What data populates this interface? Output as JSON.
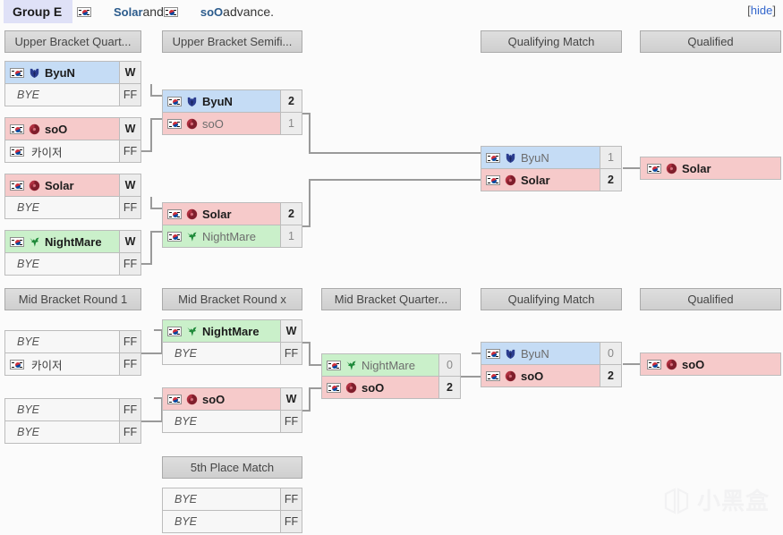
{
  "header": {
    "group_label": "Group E",
    "advance_prefix": "",
    "advance_p1": "Solar",
    "advance_join": " and ",
    "advance_p2": "soO",
    "advance_suffix": " advance.",
    "hide_open": "[",
    "hide_label": "hide",
    "hide_close": "]"
  },
  "colors": {
    "terran": "#c5dcf5",
    "zerg": "#f6caca",
    "protoss": "#caf0ca",
    "header_bg": "#dedede",
    "group_tag_bg": "#dfe1f7",
    "link": "#36c",
    "connector": "#9a9a9a"
  },
  "rounds": {
    "ub_quarter": "Upper Bracket Quart...",
    "ub_semi": "Upper Bracket Semifi...",
    "qualifying_top": "Qualifying Match",
    "qualified_top": "Qualified",
    "mid_round1": "Mid Bracket Round 1",
    "mid_roundx": "Mid Bracket Round x",
    "mid_quarter": "Mid Bracket Quarter...",
    "qualifying_bottom": "Qualifying Match",
    "qualified_bottom": "Qualified",
    "fifth_place": "5th Place Match"
  },
  "ub_quarterfinals": [
    {
      "rows": [
        {
          "name": "ByuN",
          "race": "terran",
          "flag": "kr",
          "score": "W",
          "state": "win"
        },
        {
          "name": "BYE",
          "race": "bye",
          "flag": "none",
          "score": "FF",
          "state": "bye"
        }
      ]
    },
    {
      "rows": [
        {
          "name": "soO",
          "race": "zerg",
          "flag": "kr",
          "score": "W",
          "state": "win"
        },
        {
          "name": "카이저",
          "race": "bye",
          "flag": "kr",
          "score": "FF",
          "state": "bye-named"
        }
      ]
    },
    {
      "rows": [
        {
          "name": "Solar",
          "race": "zerg",
          "flag": "kr",
          "score": "W",
          "state": "win"
        },
        {
          "name": "BYE",
          "race": "bye",
          "flag": "none",
          "score": "FF",
          "state": "bye"
        }
      ]
    },
    {
      "rows": [
        {
          "name": "NightMare",
          "race": "protoss",
          "flag": "kr",
          "score": "W",
          "state": "win"
        },
        {
          "name": "BYE",
          "race": "bye",
          "flag": "none",
          "score": "FF",
          "state": "bye"
        }
      ]
    }
  ],
  "ub_semifinals": [
    {
      "rows": [
        {
          "name": "ByuN",
          "race": "terran",
          "flag": "kr",
          "score": "2",
          "state": "win"
        },
        {
          "name": "soO",
          "race": "zerg",
          "flag": "kr",
          "score": "1",
          "state": "lose"
        }
      ]
    },
    {
      "rows": [
        {
          "name": "Solar",
          "race": "zerg",
          "flag": "kr",
          "score": "2",
          "state": "win"
        },
        {
          "name": "NightMare",
          "race": "protoss",
          "flag": "kr",
          "score": "1",
          "state": "lose"
        }
      ]
    }
  ],
  "qualifying_match_top": {
    "rows": [
      {
        "name": "ByuN",
        "race": "terran",
        "flag": "kr",
        "score": "1",
        "state": "lose"
      },
      {
        "name": "Solar",
        "race": "zerg",
        "flag": "kr",
        "score": "2",
        "state": "win"
      }
    ]
  },
  "qualified_top": {
    "rows": [
      {
        "name": "Solar",
        "race": "zerg",
        "flag": "kr",
        "score": "",
        "state": "win"
      }
    ]
  },
  "mid_round1": [
    {
      "rows": [
        {
          "name": "BYE",
          "race": "bye",
          "flag": "none",
          "score": "FF",
          "state": "bye"
        },
        {
          "name": "카이저",
          "race": "bye",
          "flag": "kr",
          "score": "FF",
          "state": "bye-named"
        }
      ]
    },
    {
      "rows": [
        {
          "name": "BYE",
          "race": "bye",
          "flag": "none",
          "score": "FF",
          "state": "bye"
        },
        {
          "name": "BYE",
          "race": "bye",
          "flag": "none",
          "score": "FF",
          "state": "bye"
        }
      ]
    }
  ],
  "mid_roundx": [
    {
      "rows": [
        {
          "name": "NightMare",
          "race": "protoss",
          "flag": "kr",
          "score": "W",
          "state": "win"
        },
        {
          "name": "BYE",
          "race": "bye",
          "flag": "none",
          "score": "FF",
          "state": "bye"
        }
      ]
    },
    {
      "rows": [
        {
          "name": "soO",
          "race": "zerg",
          "flag": "kr",
          "score": "W",
          "state": "win"
        },
        {
          "name": "BYE",
          "race": "bye",
          "flag": "none",
          "score": "FF",
          "state": "bye"
        }
      ]
    }
  ],
  "mid_quarterfinal": {
    "rows": [
      {
        "name": "NightMare",
        "race": "protoss",
        "flag": "kr",
        "score": "0",
        "state": "lose"
      },
      {
        "name": "soO",
        "race": "zerg",
        "flag": "kr",
        "score": "2",
        "state": "win"
      }
    ]
  },
  "qualifying_match_bottom": {
    "rows": [
      {
        "name": "ByuN",
        "race": "terran",
        "flag": "kr",
        "score": "0",
        "state": "lose"
      },
      {
        "name": "soO",
        "race": "zerg",
        "flag": "kr",
        "score": "2",
        "state": "win"
      }
    ]
  },
  "qualified_bottom": {
    "rows": [
      {
        "name": "soO",
        "race": "zerg",
        "flag": "kr",
        "score": "",
        "state": "win"
      }
    ]
  },
  "fifth_place_match": {
    "rows": [
      {
        "name": "BYE",
        "race": "bye",
        "flag": "none",
        "score": "FF",
        "state": "bye"
      },
      {
        "name": "BYE",
        "race": "bye",
        "flag": "none",
        "score": "FF",
        "state": "bye"
      }
    ]
  },
  "watermark": {
    "text": "小黑盒"
  }
}
